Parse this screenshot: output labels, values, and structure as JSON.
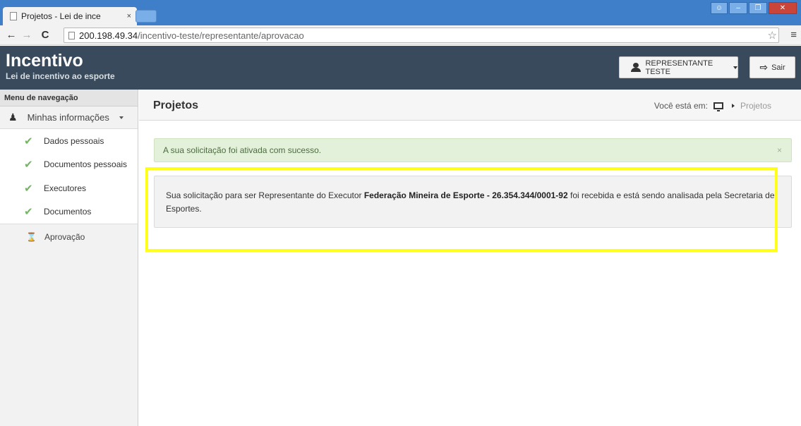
{
  "browser": {
    "tab_title": "Projetos - Lei de ince",
    "tab_close": "×",
    "url_host": "200.198.49.34",
    "url_path": "/incentivo-teste/representante/aprovacao"
  },
  "header": {
    "brand_title": "Incentivo",
    "brand_subtitle": "Lei de incentivo ao esporte",
    "user_label": "REPRESENTANTE TESTE",
    "exit_label": "Sair"
  },
  "sidebar": {
    "heading": "Menu de navegação",
    "group_label": "Minhas informações",
    "items": [
      {
        "label": "Dados pessoais",
        "icon": "check-icon"
      },
      {
        "label": "Documentos pessoais",
        "icon": "check-icon"
      },
      {
        "label": "Executores",
        "icon": "check-icon"
      },
      {
        "label": "Documentos",
        "icon": "check-icon"
      }
    ],
    "pending_item": {
      "label": "Aprovação",
      "icon": "hourglass-icon"
    }
  },
  "main": {
    "title": "Projetos",
    "breadcrumb_prefix": "Você está em:",
    "breadcrumb_current": "Projetos",
    "alert_text": "A sua solicitação foi ativada com sucesso.",
    "alert_close": "×",
    "info": {
      "text_before": "Sua solicitação para ser Representante do Executor ",
      "executor": "Federação Mineira de Esporte - 26.354.344/0001-92",
      "text_after": " foi recebida e está sendo analisada pela Secretaria de Esportes."
    }
  },
  "colors": {
    "header_bg": "#384a5c",
    "alert_bg": "#e3f0da",
    "check": "#74b566",
    "highlight": "#ffff1a"
  }
}
